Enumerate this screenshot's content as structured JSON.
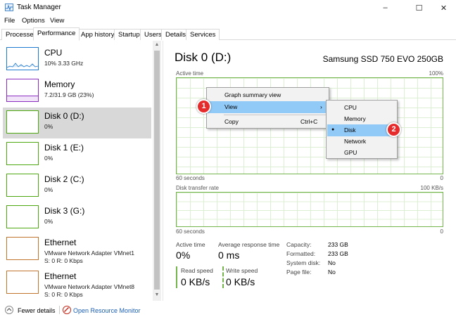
{
  "window": {
    "title": "Task Manager",
    "minimize_glyph": "–",
    "maximize_glyph": "☐",
    "close_glyph": "✕"
  },
  "menu": [
    "File",
    "Options",
    "View"
  ],
  "tabs": [
    "Processes",
    "Performance",
    "App history",
    "Startup",
    "Users",
    "Details",
    "Services"
  ],
  "active_tab": "Performance",
  "sidebar": {
    "items": [
      {
        "name": "CPU",
        "sub": "10% 3.33 GHz",
        "sub2": "",
        "color": "#1e7ad1"
      },
      {
        "name": "Memory",
        "sub": "7.2/31.9 GB (23%)",
        "sub2": "",
        "color": "#8b2dc0"
      },
      {
        "name": "Disk 0 (D:)",
        "sub": "0%",
        "sub2": "",
        "color": "#4da70e"
      },
      {
        "name": "Disk 1 (E:)",
        "sub": "0%",
        "sub2": "",
        "color": "#4da70e"
      },
      {
        "name": "Disk 2 (C:)",
        "sub": "0%",
        "sub2": "",
        "color": "#4da70e"
      },
      {
        "name": "Disk 3 (G:)",
        "sub": "0%",
        "sub2": "",
        "color": "#4da70e"
      },
      {
        "name": "Ethernet",
        "sub": "VMware Network Adapter VMnet1",
        "sub2": "S: 0 R: 0 Kbps",
        "color": "#c0742c"
      },
      {
        "name": "Ethernet",
        "sub": "VMware Network Adapter VMnet8",
        "sub2": "S: 0 R: 0 Kbps",
        "color": "#c0742c"
      }
    ],
    "selected_index": 2,
    "scroll_up_glyph": "▲",
    "scroll_down_glyph": "▼"
  },
  "detail": {
    "title": "Disk 0 (D:)",
    "model": "Samsung SSD 750 EVO 250GB",
    "graph1": {
      "label": "Active time",
      "max": "100%",
      "time": "60 seconds",
      "min": "0"
    },
    "graph2": {
      "label": "Disk transfer rate",
      "max": "100 KB/s",
      "time": "60 seconds",
      "min": "0"
    },
    "stats": {
      "active_time_label": "Active time",
      "active_time_value": "0%",
      "avg_response_label": "Average response time",
      "avg_response_value": "0 ms",
      "read_label": "Read speed",
      "read_value": "0 KB/s",
      "write_label": "Write speed",
      "write_value": "0 KB/s"
    },
    "properties": [
      {
        "label": "Capacity:",
        "value": "233 GB"
      },
      {
        "label": "Formatted:",
        "value": "233 GB"
      },
      {
        "label": "System disk:",
        "value": "No"
      },
      {
        "label": "Page file:",
        "value": "No"
      }
    ]
  },
  "bottom": {
    "fewer_details": "Fewer details",
    "resource_monitor": "Open Resource Monitor",
    "link_color": "#1a5fb4"
  },
  "context_menu": {
    "items": [
      {
        "label": "Graph summary view",
        "shortcut": ""
      },
      {
        "label": "View",
        "shortcut": "›"
      },
      {
        "label": "Copy",
        "shortcut": "Ctrl+C"
      }
    ],
    "highlighted": "View"
  },
  "submenu": {
    "items": [
      "CPU",
      "Memory",
      "Disk",
      "Network",
      "GPU"
    ],
    "checked": "Disk",
    "check_glyph": "●"
  },
  "callouts": [
    "1",
    "2"
  ]
}
